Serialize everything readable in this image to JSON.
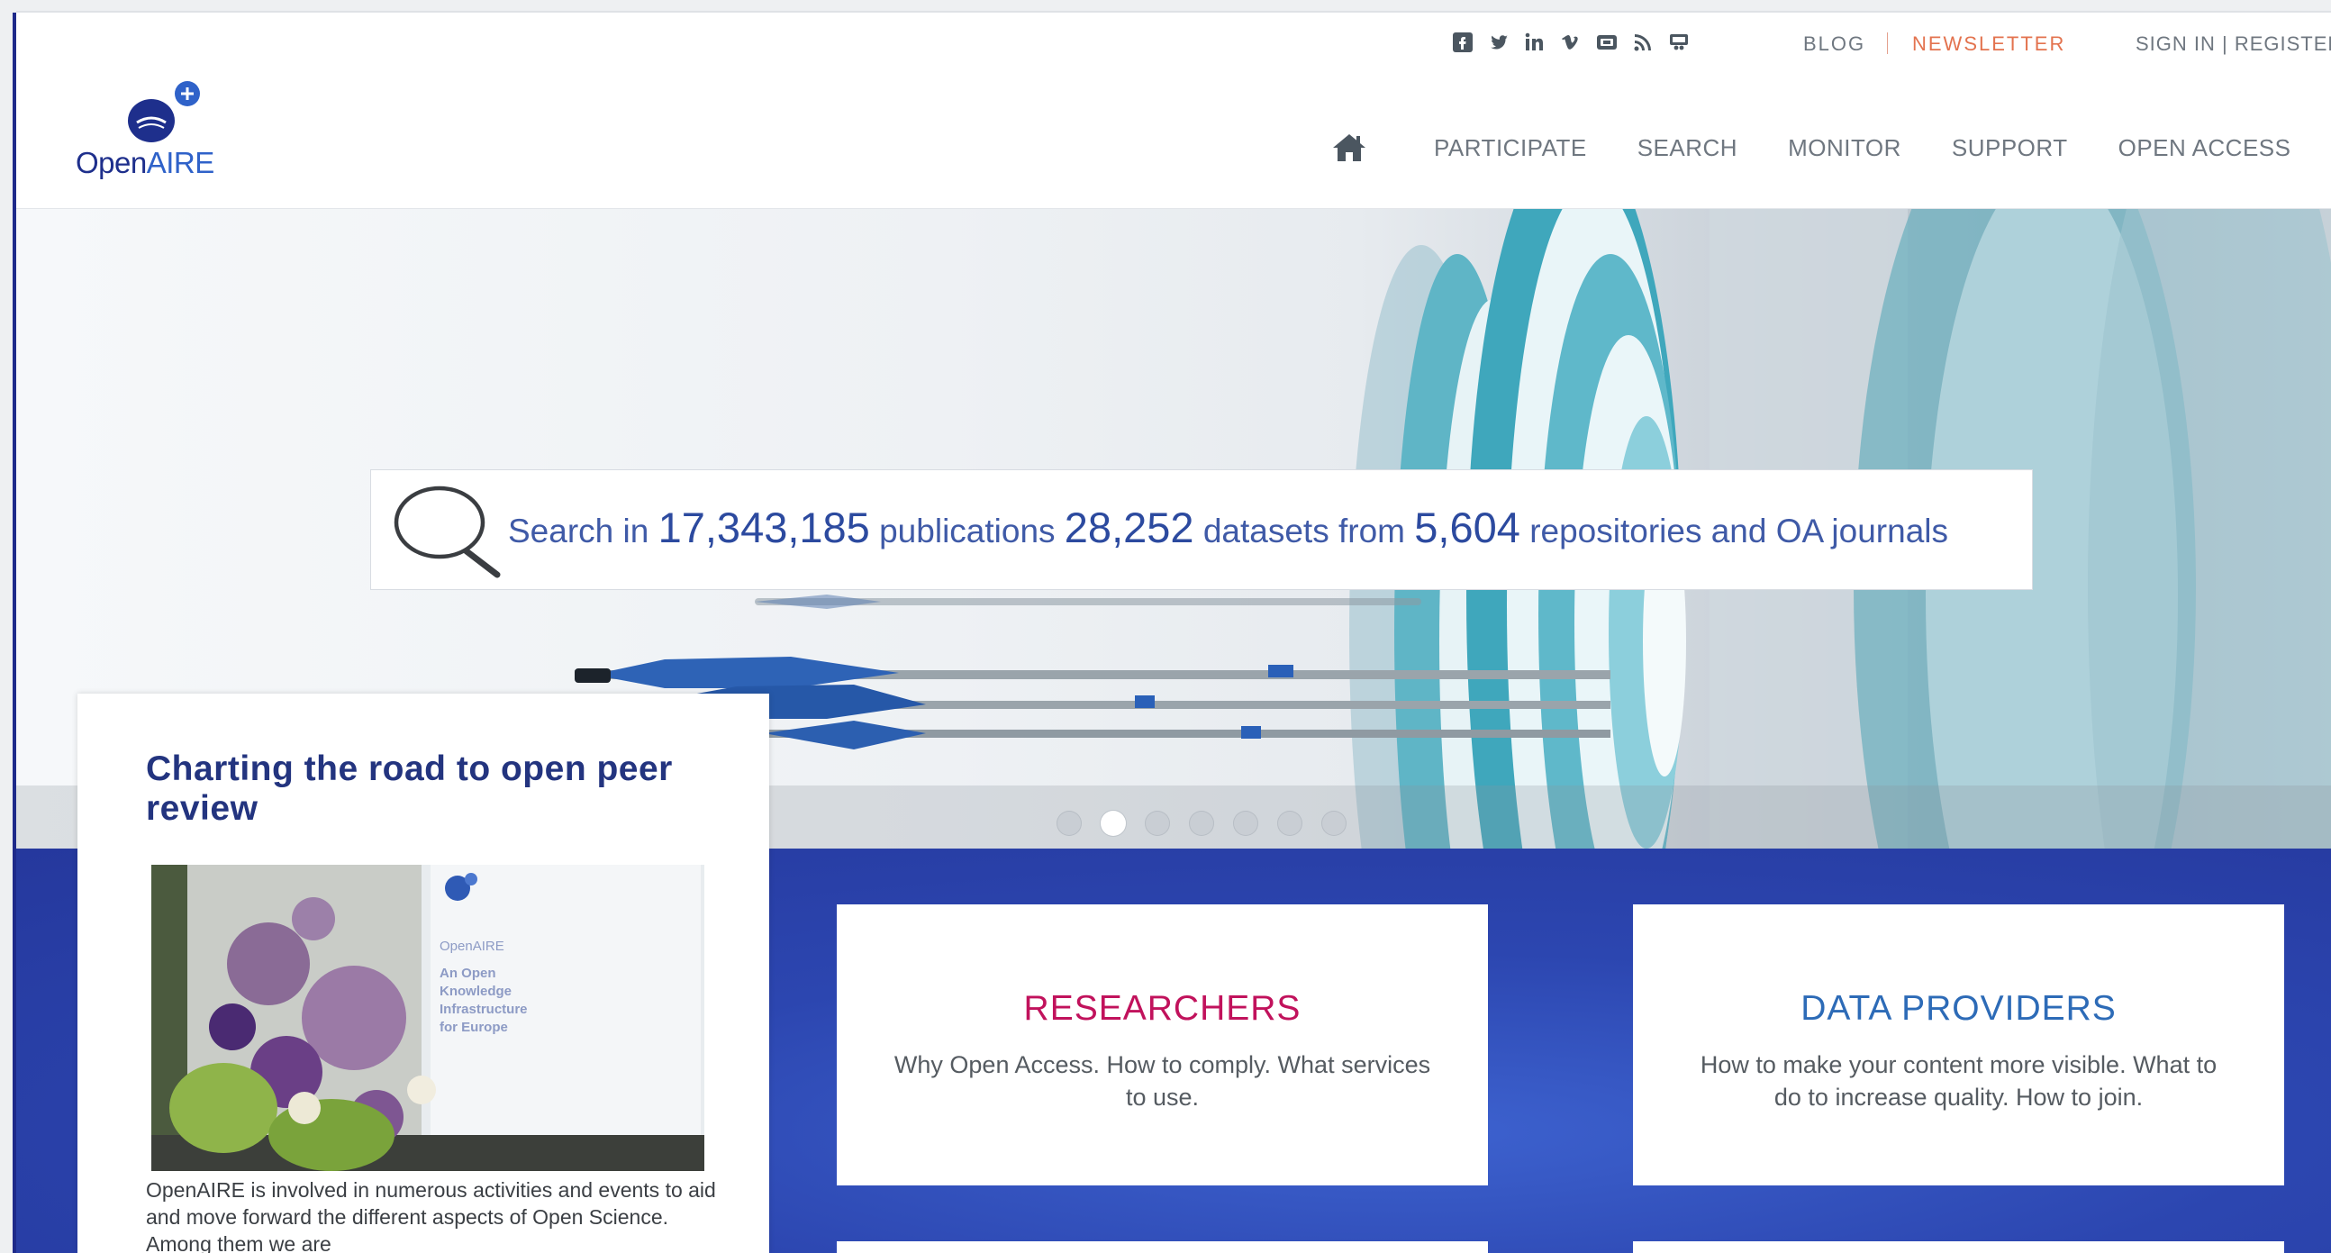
{
  "header": {
    "logo": {
      "open": "Open",
      "aire": "AIRE"
    },
    "social_icons": [
      "facebook-icon",
      "twitter-icon",
      "linkedin-icon",
      "vimeo-icon",
      "youtube-icon",
      "rss-icon",
      "slideshare-icon"
    ],
    "utility": {
      "blog": "BLOG",
      "newsletter": "NEWSLETTER",
      "sign_in": "SIGN IN | REGISTER"
    },
    "nav": {
      "home_icon": "home-icon",
      "items": [
        "PARTICIPATE",
        "SEARCH",
        "MONITOR",
        "SUPPORT",
        "OPEN ACCESS"
      ]
    },
    "colors": {
      "brand_dark": "#1e2f8c",
      "brand_light": "#2f62c9",
      "newsletter": "#e3734f"
    }
  },
  "hero": {
    "search": {
      "prefix": "Search in",
      "publications_count": "17,343,185",
      "publications_label": "publications",
      "datasets_count": "28,252",
      "datasets_label": "datasets from",
      "repositories_count": "5,604",
      "repositories_label": "repositories and OA journals"
    },
    "carousel": {
      "slide_count": 7,
      "active_index": 1
    }
  },
  "news": {
    "title": "Charting the road to open peer review",
    "body": "OpenAIRE is involved in numerous activities and events to aid and move forward the different aspects of Open Science. Among them we are"
  },
  "tiles": {
    "researchers": {
      "title": "RESEARCHERS",
      "text": "Why Open Access. How to comply. What services to use."
    },
    "data_providers": {
      "title": "DATA PROVIDERS",
      "text": "How to make your content more visible. What to do to increase quality. How to join."
    }
  },
  "colors": {
    "blue_section": "#2c46b0",
    "researchers_title": "#c1125c",
    "providers_title": "#2d6bb7"
  }
}
